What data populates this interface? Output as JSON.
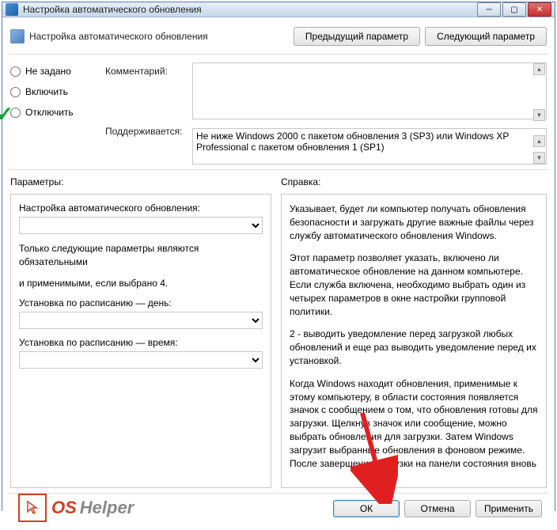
{
  "window": {
    "title": "Настройка автоматического обновления"
  },
  "header": {
    "title": "Настройка автоматического обновления",
    "prev_btn": "Предыдущий параметр",
    "next_btn": "Следующий параметр"
  },
  "radios": {
    "not_configured": "Не задано",
    "enable": "Включить",
    "disable": "Отключить"
  },
  "labels": {
    "comment": "Комментарий:",
    "supported": "Поддерживается:",
    "parameters": "Параметры:",
    "help": "Справка:"
  },
  "supported_text": "Не ниже Windows 2000 с пакетом обновления 3 (SP3) или Windows XP Professional с пакетом обновления 1 (SP1)",
  "params_panel": {
    "auto_update_label": "Настройка автоматического обновления:",
    "note1": "Только следующие параметры являются обязательными",
    "note2": "и применимыми, если выбрано 4.",
    "sched_day_label": "Установка по расписанию — день:",
    "sched_time_label": "Установка по расписанию — время:"
  },
  "help_text": {
    "p1": "Указывает, будет ли компьютер получать обновления безопасности и загружать другие важные файлы через службу автоматического обновления Windows.",
    "p2": "Этот параметр позволяет указать, включено ли автоматическое обновление на данном компьютере. Если служба включена, необходимо выбрать один из четырех параметров в окне настройки групповой политики.",
    "p3": "2 - выводить уведомление перед загрузкой любых обновлений и еще раз выводить уведомление перед их установкой.",
    "p4": "Когда Windows находит обновления, применимые к этому компьютеру, в области состояния появляется значок с сообщением о том, что обновления готовы для загрузки. Щелкнув значок или сообщение, можно выбрать обновления для загрузки. Затем Windows загрузит выбранные обновления в фоновом режиме. После завершения загрузки на панели состояния вновь"
  },
  "footer": {
    "ok": "ОК",
    "cancel": "Отмена",
    "apply": "Применить"
  },
  "logo": {
    "os": "OS",
    "helper": "Helper"
  }
}
